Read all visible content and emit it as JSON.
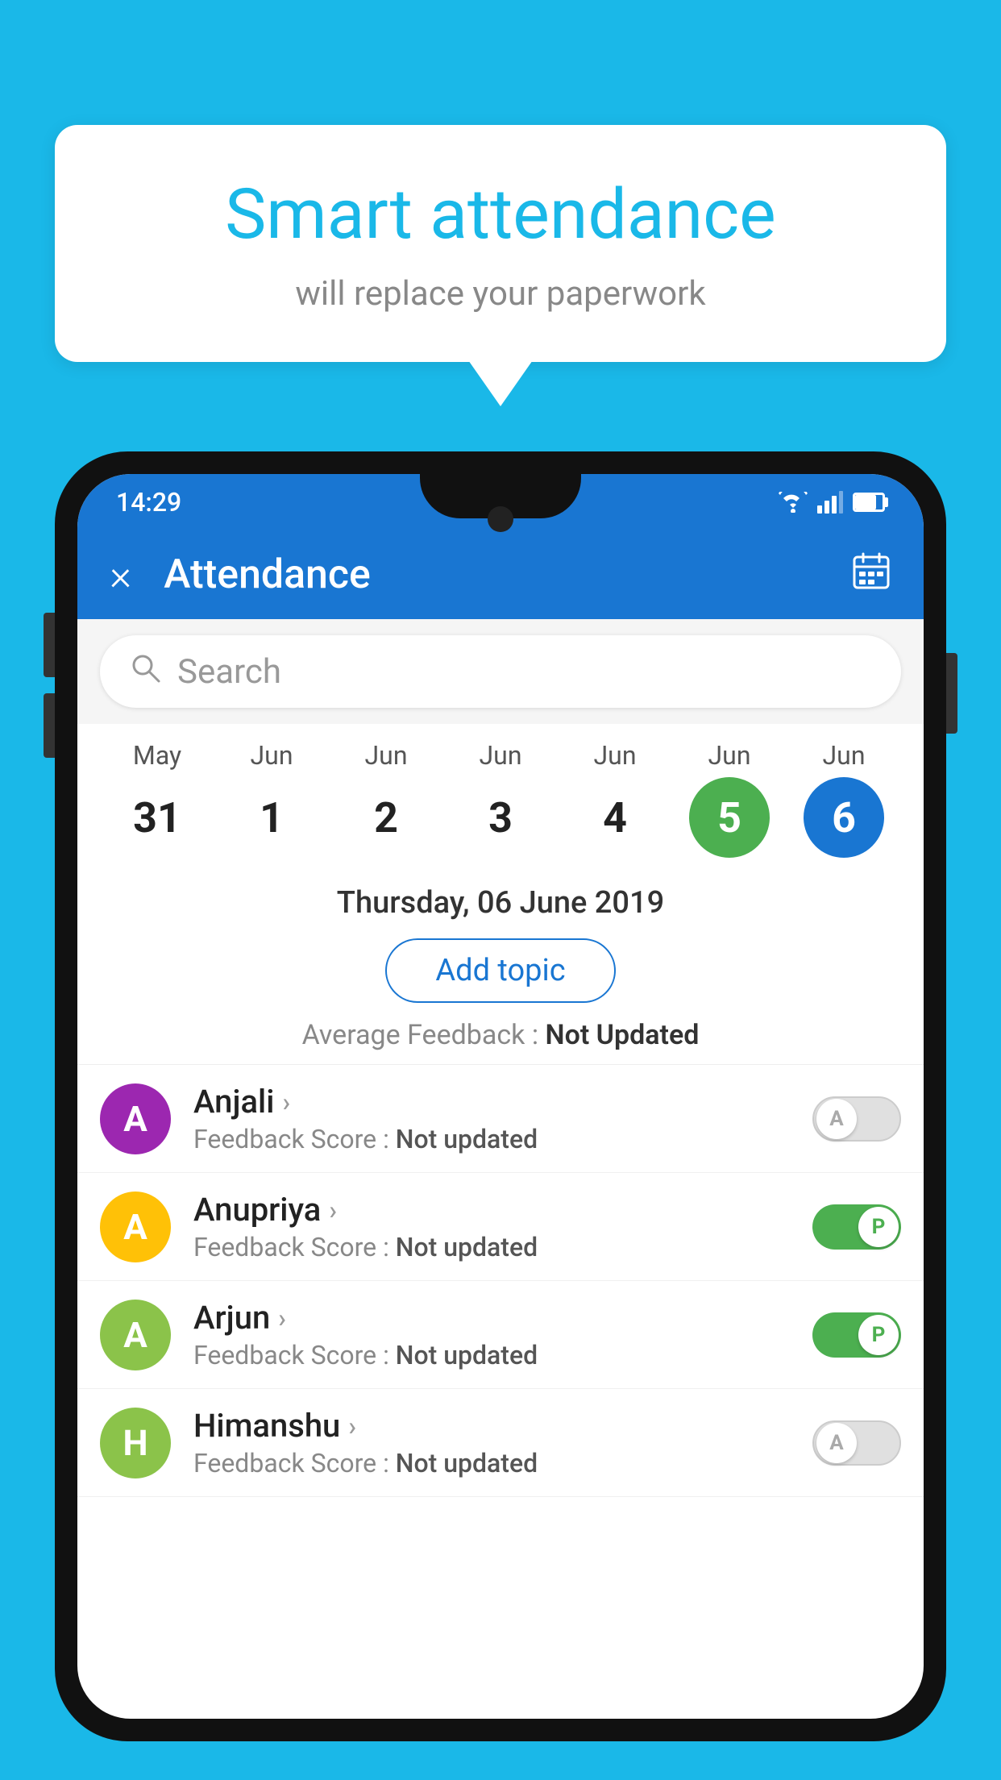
{
  "background": {
    "color": "#1ab8e8"
  },
  "speech_bubble": {
    "title": "Smart attendance",
    "subtitle": "will replace your paperwork"
  },
  "status_bar": {
    "time": "14:29"
  },
  "app_bar": {
    "title": "Attendance",
    "close_label": "×",
    "calendar_label": "📅"
  },
  "search": {
    "placeholder": "Search"
  },
  "calendar": {
    "dates": [
      {
        "month": "May",
        "day": "31",
        "style": "normal"
      },
      {
        "month": "Jun",
        "day": "1",
        "style": "normal"
      },
      {
        "month": "Jun",
        "day": "2",
        "style": "normal"
      },
      {
        "month": "Jun",
        "day": "3",
        "style": "normal"
      },
      {
        "month": "Jun",
        "day": "4",
        "style": "normal"
      },
      {
        "month": "Jun",
        "day": "5",
        "style": "today"
      },
      {
        "month": "Jun",
        "day": "6",
        "style": "selected"
      }
    ]
  },
  "selected_date": {
    "text": "Thursday, 06 June 2019",
    "add_topic_label": "Add topic",
    "avg_feedback_label": "Average Feedback : ",
    "avg_feedback_value": "Not Updated"
  },
  "students": [
    {
      "name": "Anjali",
      "avatar_letter": "A",
      "avatar_color": "#9c27b0",
      "feedback_label": "Feedback Score : ",
      "feedback_value": "Not updated",
      "toggle": "off",
      "toggle_letter": "A"
    },
    {
      "name": "Anupriya",
      "avatar_letter": "A",
      "avatar_color": "#ffc107",
      "feedback_label": "Feedback Score : ",
      "feedback_value": "Not updated",
      "toggle": "on",
      "toggle_letter": "P"
    },
    {
      "name": "Arjun",
      "avatar_letter": "A",
      "avatar_color": "#8bc34a",
      "feedback_label": "Feedback Score : ",
      "feedback_value": "Not updated",
      "toggle": "on",
      "toggle_letter": "P"
    },
    {
      "name": "Himanshu",
      "avatar_letter": "H",
      "avatar_color": "#8bc34a",
      "feedback_label": "Feedback Score : ",
      "feedback_value": "Not updated",
      "toggle": "off",
      "toggle_letter": "A"
    }
  ]
}
